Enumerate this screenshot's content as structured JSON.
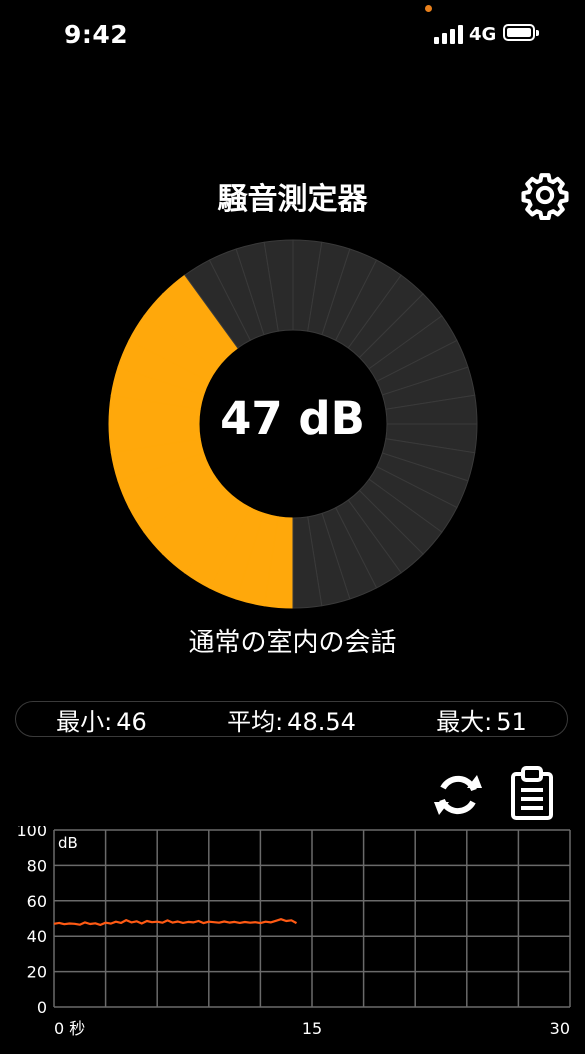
{
  "status_bar": {
    "time": "9:42",
    "network": "4G",
    "indicator_color": "#e8801c"
  },
  "header": {
    "title": "騒音測定器",
    "settings_icon": "gear-icon"
  },
  "gauge": {
    "value_label": "47 dB",
    "level": 47,
    "max": 120,
    "segments": 40,
    "active_color": "#ffa80b",
    "inactive_color": "#2a2a2a",
    "description": "通常の室内の会話"
  },
  "stats": {
    "min_label": "最小:",
    "min_value": "46",
    "avg_label": "平均:",
    "avg_value": "48.54",
    "max_label": "最大:",
    "max_value": "51"
  },
  "actions": {
    "refresh_icon": "refresh-icon",
    "report_icon": "clipboard-icon"
  },
  "chart_data": {
    "type": "line",
    "unit_label": "dB",
    "ylim": [
      0,
      100
    ],
    "y_ticks": [
      "100",
      "80",
      "60",
      "40",
      "20",
      "0"
    ],
    "xlim": [
      0,
      30
    ],
    "x_ticks": [
      "0 秒",
      "15",
      "30"
    ],
    "grid": true,
    "line_color": "#ff5a14",
    "series": [
      {
        "x": [
          0,
          0.3,
          0.6,
          0.9,
          1.2,
          1.5,
          1.8,
          2.1,
          2.4,
          2.7,
          3.0,
          3.3,
          3.6,
          3.9,
          4.2,
          4.5,
          4.8,
          5.1,
          5.4,
          5.7,
          6.0,
          6.3,
          6.6,
          6.9,
          7.2,
          7.5,
          7.8,
          8.1,
          8.4,
          8.7,
          9.0,
          9.3,
          9.6,
          9.9,
          10.2,
          10.5,
          10.8,
          11.1,
          11.4,
          11.7,
          12.0,
          12.3,
          12.6,
          12.9,
          13.2,
          13.5,
          13.8,
          14.1
        ],
        "y": [
          47,
          47.5,
          46.8,
          47.2,
          47,
          46.5,
          47.8,
          46.9,
          47.3,
          46.4,
          47.6,
          47.1,
          48.2,
          47.5,
          49.1,
          47.8,
          48.4,
          47.2,
          48.6,
          47.9,
          48.2,
          47.6,
          48.9,
          47.7,
          48.3,
          47.5,
          48.1,
          47.8,
          48.6,
          47.4,
          48.2,
          47.9,
          47.6,
          48.3,
          47.7,
          48.1,
          47.5,
          48.0,
          47.6,
          47.9,
          47.4,
          48.2,
          47.8,
          48.7,
          49.6,
          48.6,
          49.0,
          47.4
        ]
      }
    ]
  }
}
